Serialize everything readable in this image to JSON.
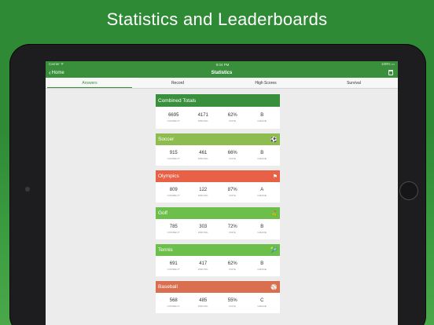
{
  "banner": {
    "title": "Statistics and Leaderboards"
  },
  "status": {
    "carrier": "Carrier ᯤ",
    "time": "9:04 PM",
    "battery": "100% ▭"
  },
  "navbar": {
    "back_label": "Home",
    "title": "Statistics"
  },
  "tabs": [
    {
      "label": "Answers"
    },
    {
      "label": "Record"
    },
    {
      "label": "High Scores"
    },
    {
      "label": "Survival"
    }
  ],
  "stat_labels": {
    "correct": "CORRECT",
    "wrong": "WRONG",
    "rate": "RATE",
    "grade": "GRADE"
  },
  "cards": [
    {
      "name": "Combined Totals",
      "color": "#3a8f3c",
      "icon": "",
      "correct": "6695",
      "wrong": "4171",
      "rate": "62%",
      "grade": "B"
    },
    {
      "name": "Soccer",
      "color": "#8fbc4e",
      "icon": "⚽",
      "correct": "915",
      "wrong": "461",
      "rate": "66%",
      "grade": "B"
    },
    {
      "name": "Olympics",
      "color": "#e86046",
      "icon": "⚑",
      "correct": "809",
      "wrong": "122",
      "rate": "87%",
      "grade": "A"
    },
    {
      "name": "Golf",
      "color": "#6cbf4a",
      "icon": "⛳",
      "correct": "785",
      "wrong": "303",
      "rate": "72%",
      "grade": "B"
    },
    {
      "name": "Tennis",
      "color": "#6cbf4a",
      "icon": "🎾",
      "correct": "691",
      "wrong": "417",
      "rate": "62%",
      "grade": "B"
    },
    {
      "name": "Baseball",
      "color": "#d96f4e",
      "icon": "⚾",
      "correct": "568",
      "wrong": "485",
      "rate": "55%",
      "grade": "C"
    }
  ]
}
